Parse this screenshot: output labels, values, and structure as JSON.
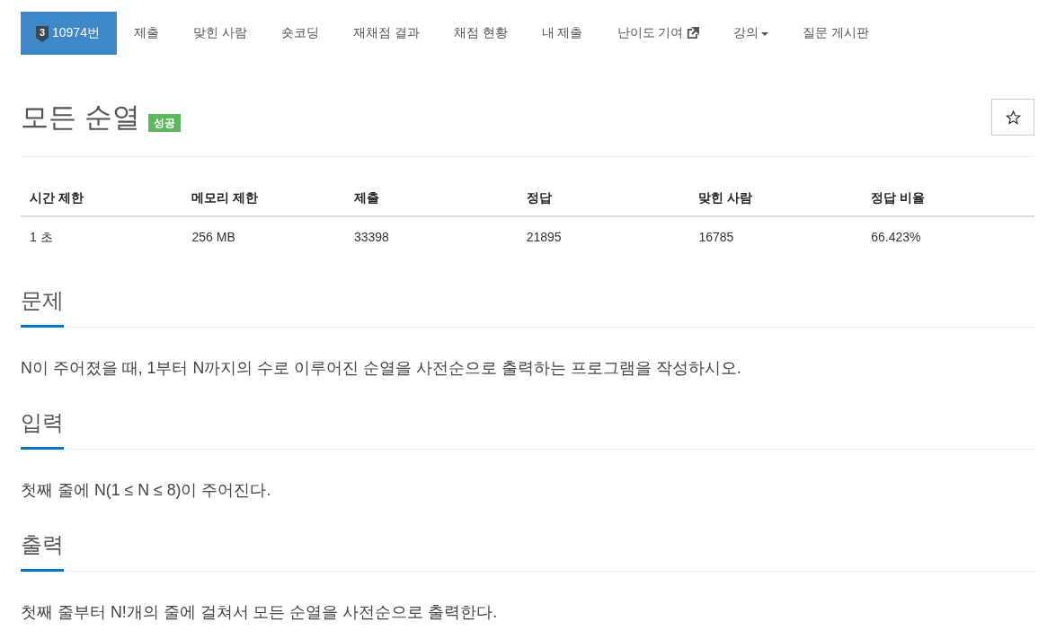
{
  "nav": {
    "tabs": [
      {
        "kind": "problem",
        "tier": "3",
        "label": "10974번",
        "selected": true
      },
      {
        "kind": "link",
        "label": "제출",
        "selected": false
      },
      {
        "kind": "link",
        "label": "맞힌 사람",
        "selected": false
      },
      {
        "kind": "link",
        "label": "숏코딩",
        "selected": false
      },
      {
        "kind": "link",
        "label": "재채점 결과",
        "selected": false
      },
      {
        "kind": "link",
        "label": "채점 현황",
        "selected": false
      },
      {
        "kind": "link",
        "label": "내 제출",
        "selected": false
      },
      {
        "kind": "external",
        "label": "난이도 기여",
        "selected": false
      },
      {
        "kind": "dropdown",
        "label": "강의",
        "selected": false
      },
      {
        "kind": "link",
        "label": "질문 게시판",
        "selected": false
      }
    ]
  },
  "problem": {
    "title": "모든 순열",
    "status": "성공",
    "starred": false
  },
  "stats": {
    "columns": [
      "시간 제한",
      "메모리 제한",
      "제출",
      "정답",
      "맞힌 사람",
      "정답 비율"
    ],
    "rows": [
      [
        "1 초",
        "256 MB",
        "33398",
        "21895",
        "16785",
        "66.423%"
      ]
    ]
  },
  "sections": [
    {
      "heading": "문제",
      "body": "N이 주어졌을 때, 1부터 N까지의 수로 이루어진 순열을 사전순으로 출력하는 프로그램을 작성하시오."
    },
    {
      "heading": "입력",
      "body": "첫째 줄에 N(1 ≤ N ≤ 8)이 주어진다."
    },
    {
      "heading": "출력",
      "body": "첫째 줄부터 N!개의 줄에 걸쳐서 모든 순열을 사전순으로 출력한다."
    }
  ]
}
